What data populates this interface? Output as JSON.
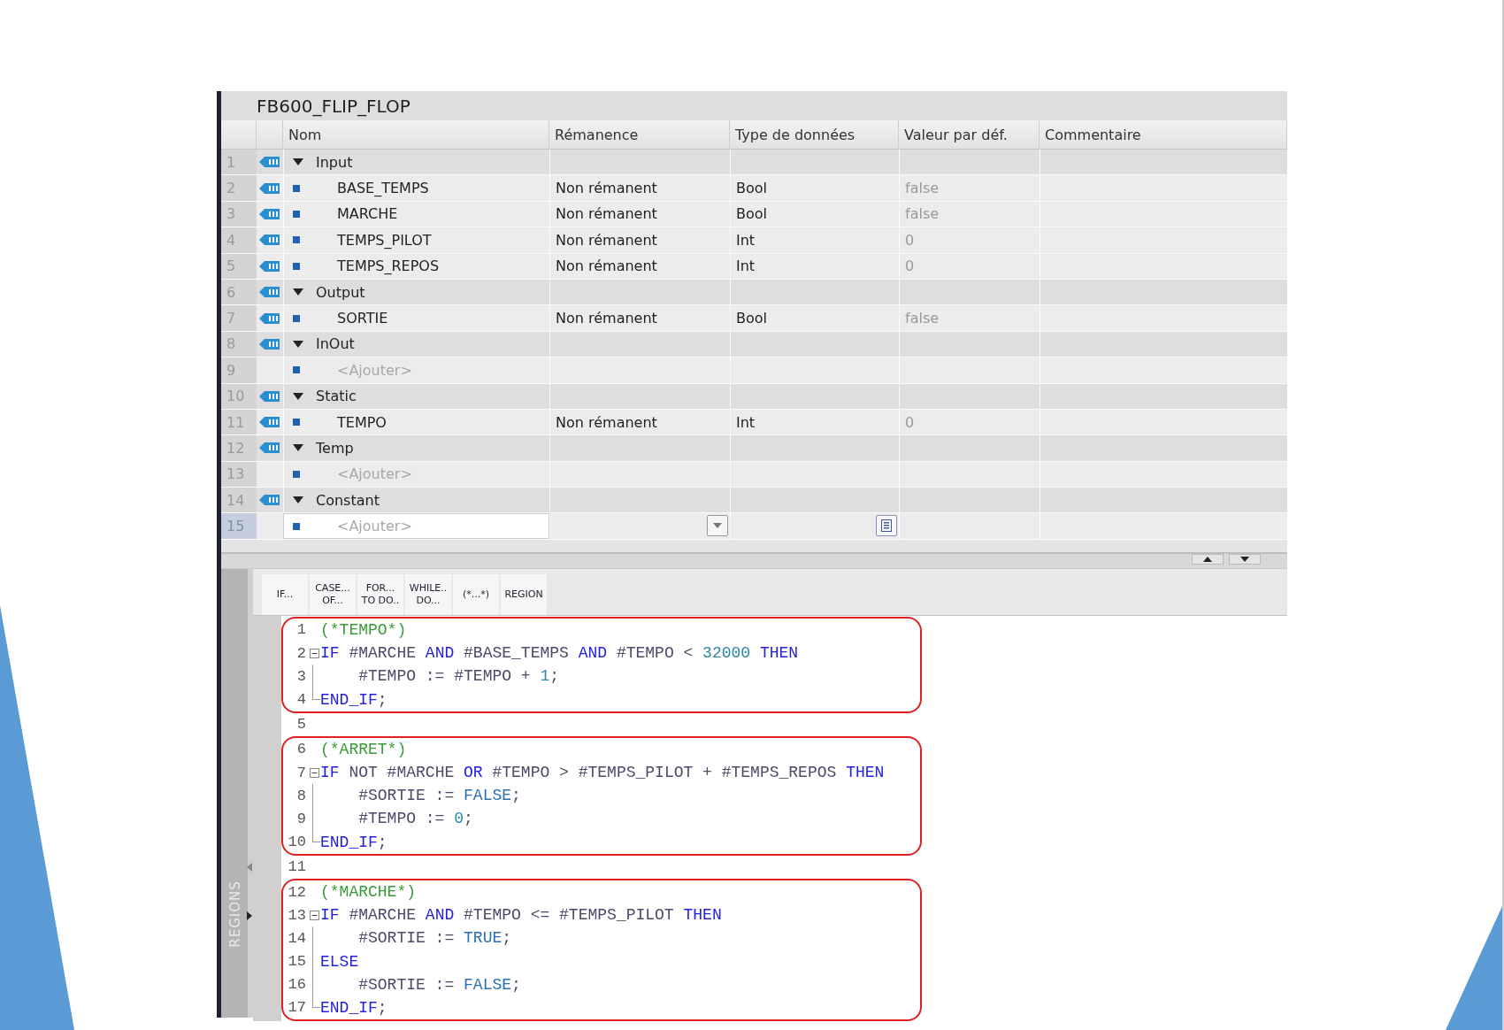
{
  "title": "FB600_FLIP_FLOP",
  "table": {
    "columns": [
      "Nom",
      "Rémanence",
      "Type de données",
      "Valeur par déf.",
      "Commentaire"
    ],
    "rows": [
      {
        "number": "1",
        "kind": "section",
        "name": "Input",
        "expanded": true,
        "selected": false
      },
      {
        "number": "2",
        "kind": "variable",
        "name": "BASE_TEMPS",
        "retain": "Non rémanent",
        "data_type": "Bool",
        "default": "false",
        "selected": false
      },
      {
        "number": "3",
        "kind": "variable",
        "name": "MARCHE",
        "retain": "Non rémanent",
        "data_type": "Bool",
        "default": "false",
        "selected": false
      },
      {
        "number": "4",
        "kind": "variable",
        "name": "TEMPS_PILOT",
        "retain": "Non rémanent",
        "data_type": "Int",
        "default": "0",
        "selected": false
      },
      {
        "number": "5",
        "kind": "variable",
        "name": "TEMPS_REPOS",
        "retain": "Non rémanent",
        "data_type": "Int",
        "default": "0",
        "selected": false
      },
      {
        "number": "6",
        "kind": "section",
        "name": "Output",
        "expanded": true,
        "selected": false
      },
      {
        "number": "7",
        "kind": "variable",
        "name": "SORTIE",
        "retain": "Non rémanent",
        "data_type": "Bool",
        "default": "false",
        "selected": false
      },
      {
        "number": "8",
        "kind": "section",
        "name": "InOut",
        "expanded": true,
        "selected": false
      },
      {
        "number": "9",
        "kind": "add",
        "name": "<Ajouter>",
        "selected": false
      },
      {
        "number": "10",
        "kind": "section",
        "name": "Static",
        "expanded": true,
        "selected": false
      },
      {
        "number": "11",
        "kind": "variable",
        "name": "TEMPO",
        "retain": "Non rémanent",
        "data_type": "Int",
        "default": "0",
        "selected": false
      },
      {
        "number": "12",
        "kind": "section",
        "name": "Temp",
        "expanded": true,
        "selected": false
      },
      {
        "number": "13",
        "kind": "add",
        "name": "<Ajouter>",
        "selected": false
      },
      {
        "number": "14",
        "kind": "section",
        "name": "Constant",
        "expanded": true,
        "selected": false
      },
      {
        "number": "15",
        "kind": "add",
        "name": "<Ajouter>",
        "selected": true
      }
    ]
  },
  "toolbar": [
    {
      "lines": [
        "IF..."
      ]
    },
    {
      "lines": [
        "CASE...",
        "OF..."
      ]
    },
    {
      "lines": [
        "FOR...",
        "TO DO.."
      ]
    },
    {
      "lines": [
        "WHILE..",
        "DO..."
      ]
    },
    {
      "lines": [
        "(*...*)"
      ]
    },
    {
      "lines": [
        "REGION"
      ]
    }
  ],
  "regions_panel": {
    "label": "REGIONS"
  },
  "code_blocks": [
    {
      "kind": "boxed",
      "lines": [
        {
          "number": "1",
          "kind": "plain",
          "tokens": [
            {
              "kind": "comment",
              "text": "(*TEMPO*)"
            }
          ]
        },
        {
          "number": "2",
          "kind": "fold_start",
          "tokens": [
            {
              "kind": "keyword",
              "text": "IF"
            },
            {
              "kind": "plain",
              "text": " #MARCHE "
            },
            {
              "kind": "keyword",
              "text": "AND"
            },
            {
              "kind": "plain",
              "text": " #BASE_TEMPS "
            },
            {
              "kind": "keyword",
              "text": "AND"
            },
            {
              "kind": "plain",
              "text": " #TEMPO < "
            },
            {
              "kind": "number",
              "text": "32000"
            },
            {
              "kind": "keyword",
              "text": " THEN"
            }
          ]
        },
        {
          "number": "3",
          "kind": "fold_inside",
          "tokens": [
            {
              "kind": "plain",
              "text": "    #TEMPO := #TEMPO + "
            },
            {
              "kind": "number",
              "text": "1"
            },
            {
              "kind": "plain",
              "text": ";"
            }
          ]
        },
        {
          "number": "4",
          "kind": "fold_end",
          "tokens": [
            {
              "kind": "keyword",
              "text": "END_IF"
            },
            {
              "kind": "plain",
              "text": ";"
            }
          ]
        }
      ]
    },
    {
      "kind": "plain",
      "lines": [
        {
          "number": "5"
        }
      ]
    },
    {
      "kind": "boxed",
      "lines": [
        {
          "number": "6",
          "kind": "plain",
          "tokens": [
            {
              "kind": "comment",
              "text": "(*ARRET*)"
            }
          ]
        },
        {
          "number": "7",
          "kind": "fold_start",
          "tokens": [
            {
              "kind": "keyword",
              "text": "IF"
            },
            {
              "kind": "plain",
              "text": " NOT #MARCHE "
            },
            {
              "kind": "keyword",
              "text": "OR"
            },
            {
              "kind": "plain",
              "text": " #TEMPO > #TEMPS_PILOT + #TEMPS_REPOS "
            },
            {
              "kind": "keyword",
              "text": "THEN"
            }
          ]
        },
        {
          "number": "8",
          "kind": "fold_inside",
          "tokens": [
            {
              "kind": "plain",
              "text": "    #SORTIE := "
            },
            {
              "kind": "constant",
              "text": "FALSE"
            },
            {
              "kind": "plain",
              "text": ";"
            }
          ]
        },
        {
          "number": "9",
          "kind": "fold_inside",
          "tokens": [
            {
              "kind": "plain",
              "text": "    #TEMPO := "
            },
            {
              "kind": "number",
              "text": "0"
            },
            {
              "kind": "plain",
              "text": ";"
            }
          ]
        },
        {
          "number": "10",
          "kind": "fold_end",
          "tokens": [
            {
              "kind": "keyword",
              "text": "END_IF"
            },
            {
              "kind": "plain",
              "text": ";"
            }
          ]
        }
      ]
    },
    {
      "kind": "plain",
      "lines": [
        {
          "number": "11"
        }
      ]
    },
    {
      "kind": "boxed",
      "lines": [
        {
          "number": "12",
          "kind": "plain",
          "tokens": [
            {
              "kind": "comment",
              "text": "(*MARCHE*)"
            }
          ]
        },
        {
          "number": "13",
          "kind": "fold_start",
          "tokens": [
            {
              "kind": "keyword",
              "text": "IF"
            },
            {
              "kind": "plain",
              "text": " #MARCHE "
            },
            {
              "kind": "keyword",
              "text": "AND"
            },
            {
              "kind": "plain",
              "text": " #TEMPO <= #TEMPS_PILOT "
            },
            {
              "kind": "keyword",
              "text": "THEN"
            }
          ]
        },
        {
          "number": "14",
          "kind": "fold_inside",
          "tokens": [
            {
              "kind": "plain",
              "text": "    #SORTIE := "
            },
            {
              "kind": "constant",
              "text": "TRUE"
            },
            {
              "kind": "plain",
              "text": ";"
            }
          ]
        },
        {
          "number": "15",
          "kind": "fold_inside",
          "tokens": [
            {
              "kind": "keyword",
              "text": "ELSE"
            }
          ]
        },
        {
          "number": "16",
          "kind": "fold_inside",
          "tokens": [
            {
              "kind": "plain",
              "text": "    #SORTIE := "
            },
            {
              "kind": "constant",
              "text": "FALSE"
            },
            {
              "kind": "plain",
              "text": ";"
            }
          ]
        },
        {
          "number": "17",
          "kind": "fold_end",
          "tokens": [
            {
              "kind": "keyword",
              "text": "END_IF"
            },
            {
              "kind": "plain",
              "text": ";"
            }
          ]
        }
      ]
    }
  ]
}
